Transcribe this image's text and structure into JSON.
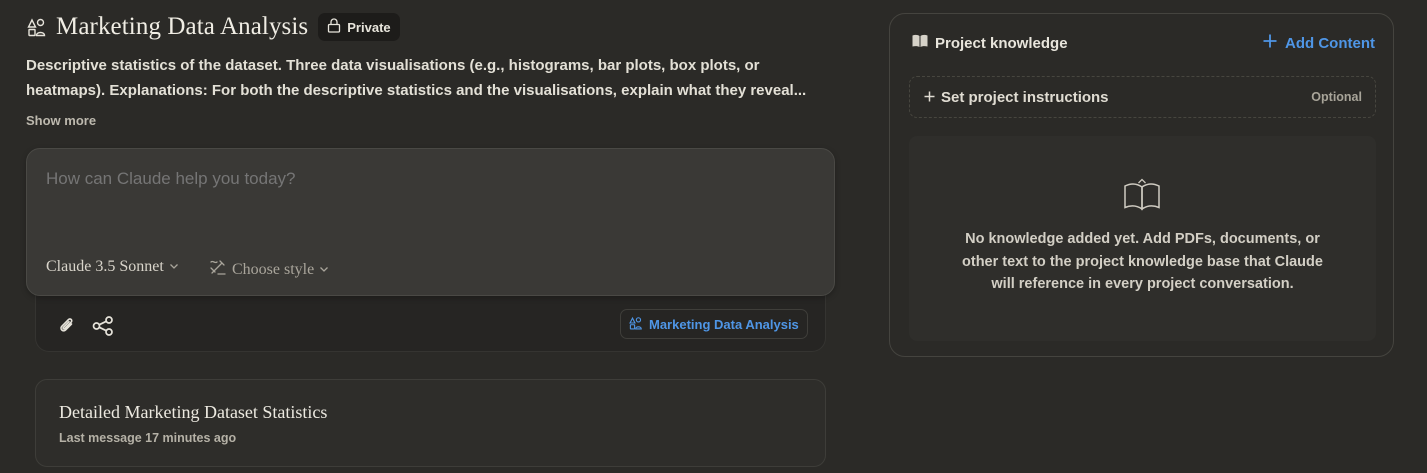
{
  "project": {
    "title": "Marketing Data Analysis",
    "visibility": "Private",
    "description_lines": [
      "Descriptive statistics of the dataset. Three data visualisations (e.g., histograms, bar plots, box plots, or",
      "heatmaps). Explanations: For both the descriptive statistics and the visualisations, explain what they reveal..."
    ],
    "show_more": "Show more"
  },
  "composer": {
    "placeholder": "How can Claude help you today?",
    "model": "Claude 3.5 Sonnet",
    "style": "Choose style",
    "project_chip": "Marketing Data Analysis"
  },
  "chats": [
    {
      "title": "Detailed Marketing Dataset Statistics",
      "meta": "Last message 17 minutes ago"
    }
  ],
  "knowledge": {
    "heading": "Project knowledge",
    "add_content": "Add Content",
    "instructions_label": "Set project instructions",
    "instructions_optional": "Optional",
    "empty_lines": [
      "No knowledge added yet. Add PDFs, documents, or",
      "other text to the project knowledge base that Claude",
      "will reference in every project conversation."
    ]
  },
  "colors": {
    "background": "#2b2a27",
    "accent_blue": "#4f96e6",
    "composer_bg": "#3a3936"
  },
  "icons": [
    "project-icon",
    "lock-icon",
    "chevron-down-icon",
    "style-icon",
    "paperclip-icon",
    "share-icon",
    "book-icon",
    "plus-icon"
  ]
}
